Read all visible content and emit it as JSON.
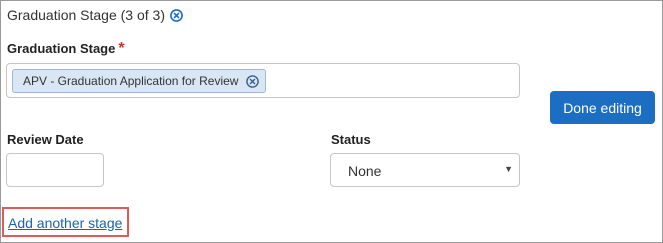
{
  "section": {
    "title": "Graduation Stage (3 of 3)",
    "remove_icon": "circle-x-icon"
  },
  "graduation_stage": {
    "label": "Graduation Stage",
    "required_marker": "*",
    "selected": [
      {
        "label": "APV - Graduation Application for Review",
        "remove_icon": "circle-x-icon"
      }
    ]
  },
  "done_button": {
    "label": "Done editing"
  },
  "review_date": {
    "label": "Review Date",
    "value": ""
  },
  "status": {
    "label": "Status",
    "selected": "None",
    "icon": "caret-down-icon"
  },
  "add_stage_link": {
    "label": "Add another stage",
    "highlight_color": "#e05a5a"
  },
  "colors": {
    "accent": "#1b6ec2",
    "link": "#1a63b4",
    "chip_bg": "#d9e7f5",
    "required": "#c0392b"
  }
}
